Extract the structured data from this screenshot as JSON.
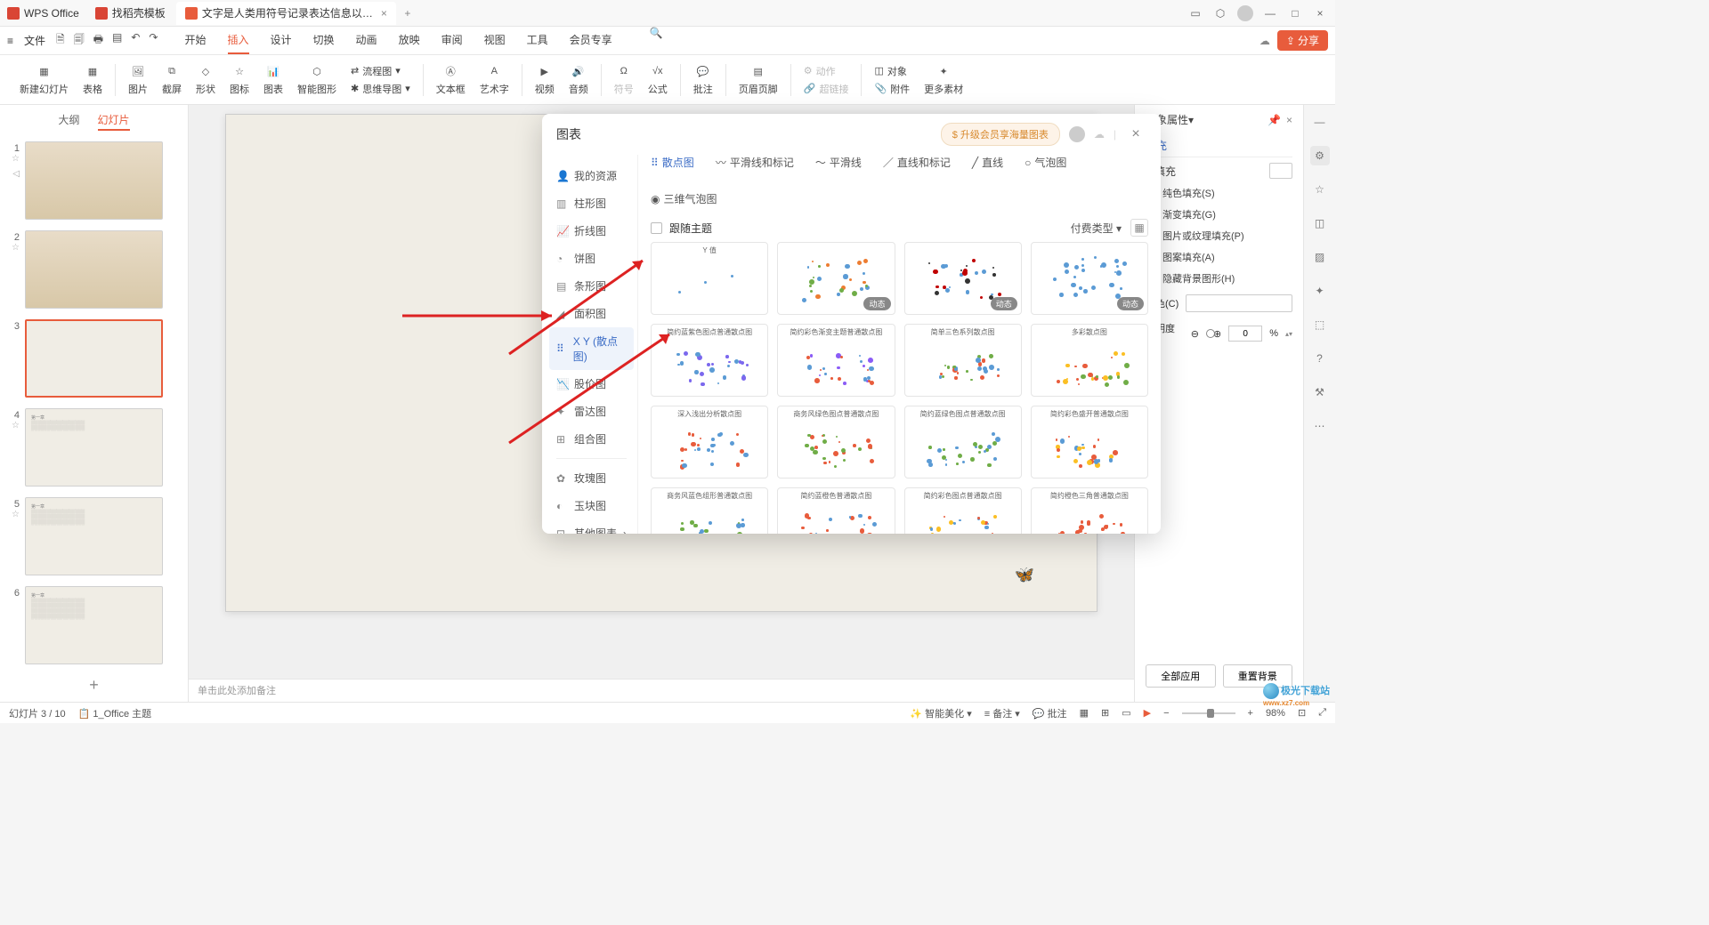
{
  "titlebar": {
    "app_name": "WPS Office",
    "tabs": [
      {
        "label": "找稻壳模板"
      },
      {
        "label": "文字是人类用符号记录表达信息以…"
      }
    ]
  },
  "menu": {
    "file": "文件",
    "tabs": [
      "开始",
      "插入",
      "设计",
      "切换",
      "动画",
      "放映",
      "审阅",
      "视图",
      "工具",
      "会员专享"
    ],
    "active": "插入",
    "share": "分享"
  },
  "ribbon": {
    "new_slide": "新建幻灯片",
    "table": "表格",
    "picture": "图片",
    "screenshot": "截屏",
    "shapes": "形状",
    "icons": "图标",
    "charts": "图表",
    "smart_graphics": "智能图形",
    "flowchart": "流程图",
    "mindmap": "思维导图",
    "textbox": "文本框",
    "wordart": "艺术字",
    "video": "视频",
    "audio": "音频",
    "symbol": "符号",
    "equation": "公式",
    "comment": "批注",
    "header_footer": "页眉页脚",
    "action": "动作",
    "hyperlink": "超链接",
    "object": "对象",
    "attachment": "附件",
    "more_assets": "更多素材"
  },
  "slide_panel": {
    "outline": "大纲",
    "slides": "幻灯片"
  },
  "modal": {
    "title": "图表",
    "upgrade": "升级会员享海量图表",
    "categories": {
      "my_assets": "我的资源",
      "bar": "柱形图",
      "line": "折线图",
      "pie": "饼图",
      "hbar": "条形图",
      "area": "面积图",
      "xy": "X Y (散点图)",
      "stock": "股价图",
      "radar": "雷达图",
      "combo": "组合图",
      "rose": "玫瑰图",
      "jade": "玉块图",
      "other": "其他图表"
    },
    "subtypes": {
      "scatter": "散点图",
      "smooth_marker": "平滑线和标记",
      "smooth": "平滑线",
      "straight_marker": "直线和标记",
      "straight": "直线",
      "bubble": "气泡图",
      "bubble3d": "三维气泡图"
    },
    "follow_theme": "跟随主题",
    "filter": "付费类型",
    "chart_titles": {
      "c1": "Y 值",
      "c5": "简约蓝紫色图点普通散点图",
      "c6": "简约彩色渐变主题普通散点图",
      "c7": "简单三色系列散点图",
      "c8": "多彩散点图",
      "c9": "深入浅出分析散点图",
      "c10": "商务风绿色图点普通散点图",
      "c11": "简约蓝绿色图点普通散点图",
      "c12": "简约彩色盛开普通散点图",
      "c13": "商务风蓝色组形普通散点图",
      "c14": "简约蓝橙色普通散点图",
      "c15": "简约彩色图点普通散点图",
      "c16": "简约橙色三角普通散点图"
    },
    "dynamic": "动态"
  },
  "notes": "单击此处添加备注",
  "right_panel": {
    "title": "对象属性",
    "tab_fill": "填充",
    "section": "填充",
    "options": {
      "solid": "纯色填充(S)",
      "gradient": "渐变填充(G)",
      "picture": "图片或纹理填充(P)",
      "pattern": "图案填充(A)",
      "hide_bg": "隐藏背景图形(H)"
    },
    "color": "颜色(C)",
    "opacity": "透明度(T)",
    "opacity_val": "0",
    "opacity_unit": "%",
    "apply_all": "全部应用",
    "reset": "重置背景"
  },
  "statusbar": {
    "slide_info": "幻灯片 3 / 10",
    "theme": "1_Office 主题",
    "smart_beautify": "智能美化",
    "notes": "备注",
    "comments": "批注",
    "zoom": "98%"
  },
  "watermark": {
    "brand": "极光下载站",
    "url": "www.xz7.com"
  }
}
